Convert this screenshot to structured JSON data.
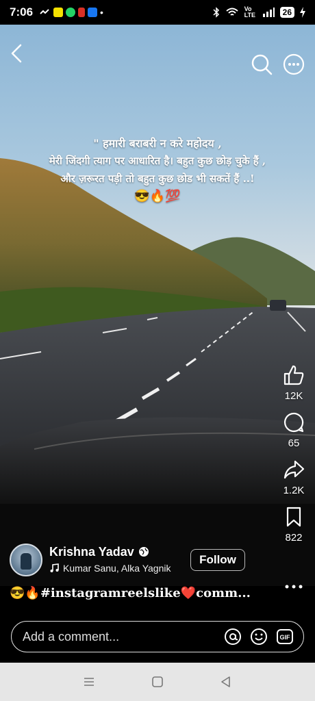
{
  "status_bar": {
    "time": "7:06",
    "network": "Vo LTE",
    "battery": "26"
  },
  "overlay_text": {
    "line1": "\" हमारी बराबरी न करे महोदय ,",
    "line2": "मेरी जिंदगी त्याग पर आधारित है। बहुत कुछ छोड़ चुके हैं ,",
    "line3": "और ज़रूरत पड़ी तो बहुत कुछ छोड भी सकतें हैं ..!",
    "emojis": "😎🔥💯"
  },
  "actions": {
    "likes": "12K",
    "comments": "65",
    "shares": "1.2K",
    "saves": "822"
  },
  "author": {
    "name": "Krishna Yadav",
    "music": "Kumar Sanu, Alka Yagnik",
    "follow_label": "Follow"
  },
  "caption": "😎🔥#instagramreelslike❤️comm...",
  "comment": {
    "placeholder": "Add a comment..."
  },
  "icons": {
    "back": "chevron-left-icon",
    "search": "search-icon",
    "more": "more-circle-icon",
    "like": "thumbs-up-icon",
    "comment": "comment-bubble-icon",
    "share": "share-arrow-icon",
    "save": "bookmark-icon",
    "at": "at-icon",
    "emoji": "smiley-icon",
    "gif": "gif-icon"
  },
  "colors": {
    "background": "#000000",
    "nav_bar": "#e6e6e6"
  }
}
